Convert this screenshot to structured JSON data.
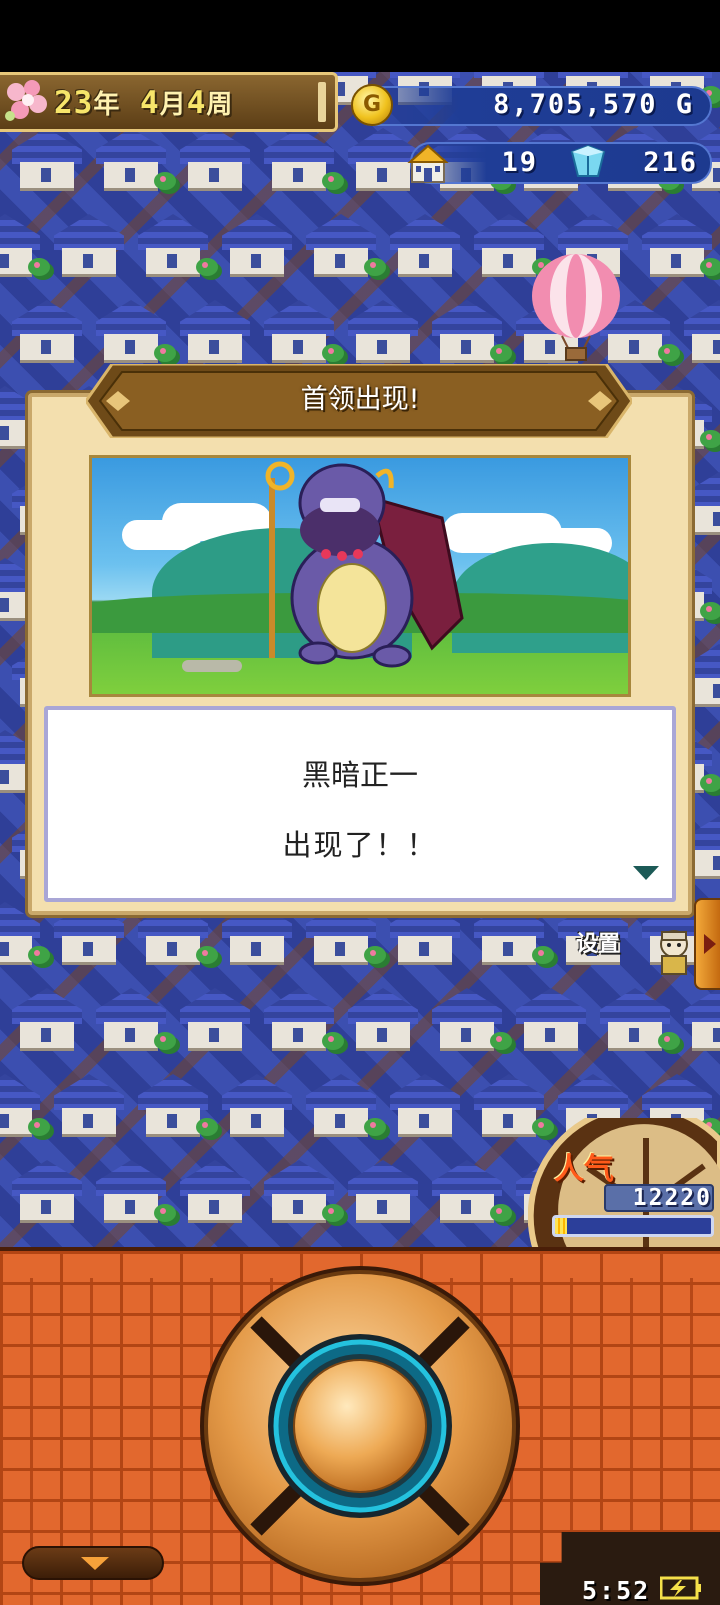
{
  "hud": {
    "date": {
      "year": "23",
      "year_unit": "年",
      "month": "4",
      "month_unit": "月",
      "week": "4",
      "week_unit": "周"
    },
    "gold": "8,705,570",
    "gold_unit": "G",
    "coin_letter": "G",
    "population": "19",
    "crystals": "216"
  },
  "dialog": {
    "title": "首领出现!",
    "line1": "黑暗正一",
    "line2": "出现了！！"
  },
  "settings": {
    "label": "设置"
  },
  "popularity": {
    "label": "人气",
    "value": "12220",
    "gauge_fraction": 0.08
  },
  "clock": {
    "time": "5:52"
  },
  "colors": {
    "gold_text": "#f7e56a",
    "panel_blue": "#1f3d96",
    "brick": "#e2682e",
    "dialog_bg": "#f3dfae"
  }
}
